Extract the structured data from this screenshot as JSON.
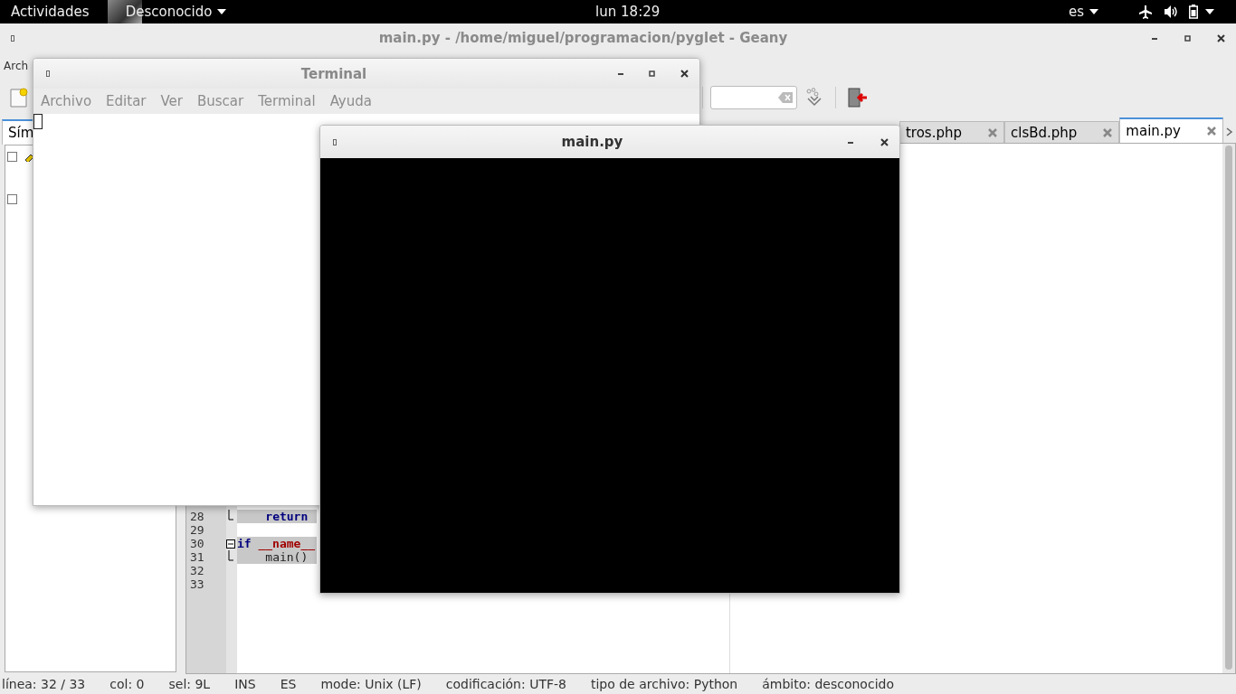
{
  "top_bar": {
    "activities": "Actividades",
    "app_menu": "Desconocido",
    "clock": "lun 18:29",
    "language": "es"
  },
  "geany": {
    "title": "main.py - /home/miguel/programacion/pyglet - Geany",
    "menu": [
      "Arch"
    ],
    "sidebar_tab": "Sím",
    "tabs": [
      {
        "label": "tros.php",
        "selected": false
      },
      {
        "label": "clsBd.php",
        "selected": false
      },
      {
        "label": "main.py",
        "selected": true
      }
    ],
    "code_lines": [
      {
        "number": "28",
        "fold_start": false,
        "fold_end": true,
        "highlighted": true,
        "tokens": [
          {
            "text": "    return",
            "kind": "keyword"
          }
        ]
      },
      {
        "number": "29",
        "fold_start": false,
        "fold_end": false
      },
      {
        "number": "30",
        "fold_start": true,
        "fold_end": false,
        "highlighted": true,
        "tokens": [
          {
            "text": "if",
            "kind": "keyword"
          },
          {
            "text": "__name__",
            "kind": "dunder"
          }
        ]
      },
      {
        "number": "31",
        "fold_start": false,
        "fold_end": true,
        "highlighted": true,
        "tokens": [
          {
            "text": "    main()",
            "kind": "plain"
          }
        ]
      },
      {
        "number": "32",
        "fold_start": false,
        "fold_end": false
      },
      {
        "number": "33",
        "fold_start": false,
        "fold_end": false
      }
    ],
    "status": [
      "línea: 32 / 33",
      "col: 0",
      "sel: 9L",
      "INS",
      "ES",
      "mode: Unix (LF)",
      "codificación: UTF-8",
      "tipo de archivo: Python",
      "ámbito: desconocido"
    ]
  },
  "terminal": {
    "title": "Terminal",
    "menu": [
      "Archivo",
      "Editar",
      "Ver",
      "Buscar",
      "Terminal",
      "Ayuda"
    ]
  },
  "game_window": {
    "title": "main.py"
  }
}
